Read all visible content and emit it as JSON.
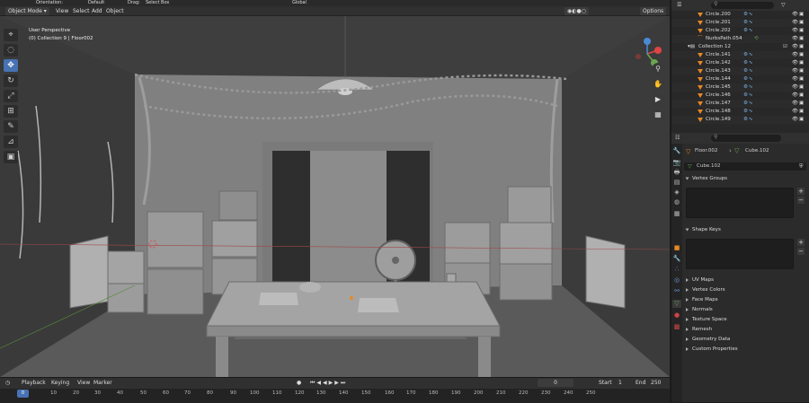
{
  "topbar": {
    "orientation_label": "Orientation:",
    "orientation_value": "Default",
    "drag_label": "Drag:",
    "drag_value": "Select Box",
    "transform_value": "Global",
    "options_label": "Options"
  },
  "header": {
    "mode": "Object Mode",
    "menu": [
      "View",
      "Select",
      "Add",
      "Object"
    ]
  },
  "viewport": {
    "info_line1": "User Perspective",
    "info_line2": "(0) Collection 9 | Floor002"
  },
  "toolbar": {
    "tools": [
      "cursor-icon",
      "select-icon",
      "move-icon",
      "rotate-icon",
      "scale-icon",
      "transform-icon",
      "annotate-icon",
      "measure-icon",
      "add-cube-icon"
    ]
  },
  "outliner": {
    "rows": [
      {
        "label": "Circle.200",
        "indent": 2
      },
      {
        "label": "Circle.201",
        "indent": 2
      },
      {
        "label": "Circle.202",
        "indent": 2
      },
      {
        "label": "NurbsPath.054",
        "indent": 2
      },
      {
        "label": "Collection 12",
        "indent": 1
      },
      {
        "label": "Circle.141",
        "indent": 2
      },
      {
        "label": "Circle.142",
        "indent": 2
      },
      {
        "label": "Circle.143",
        "indent": 2
      },
      {
        "label": "Circle.144",
        "indent": 2
      },
      {
        "label": "Circle.145",
        "indent": 2
      },
      {
        "label": "Circle.146",
        "indent": 2
      },
      {
        "label": "Circle.147",
        "indent": 2
      },
      {
        "label": "Circle.148",
        "indent": 2
      },
      {
        "label": "Circle.149",
        "indent": 2
      }
    ]
  },
  "properties": {
    "object_name": "Floor.002",
    "mesh_name": "Cube.102",
    "mesh_field": "Cube.102",
    "sections": [
      "Vertex Groups",
      "Shape Keys",
      "UV Maps",
      "Vertex Colors",
      "Face Maps",
      "Normals",
      "Texture Space",
      "Remesh",
      "Geometry Data",
      "Custom Properties"
    ]
  },
  "timeline": {
    "menu": [
      "Playback",
      "Keying",
      "View",
      "Marker"
    ],
    "current_frame": "0",
    "start_label": "Start",
    "start_value": "1",
    "end_label": "End",
    "end_value": "250",
    "ticks": [
      "0",
      "10",
      "20",
      "30",
      "40",
      "50",
      "60",
      "70",
      "80",
      "90",
      "100",
      "110",
      "120",
      "130",
      "140",
      "150",
      "160",
      "170",
      "180",
      "190",
      "200",
      "210",
      "220",
      "230",
      "240",
      "250"
    ]
  },
  "colors": {
    "accent": "#4772b3",
    "object_orange": "#e38a25",
    "viewport_bg": "#3e3e3e"
  }
}
